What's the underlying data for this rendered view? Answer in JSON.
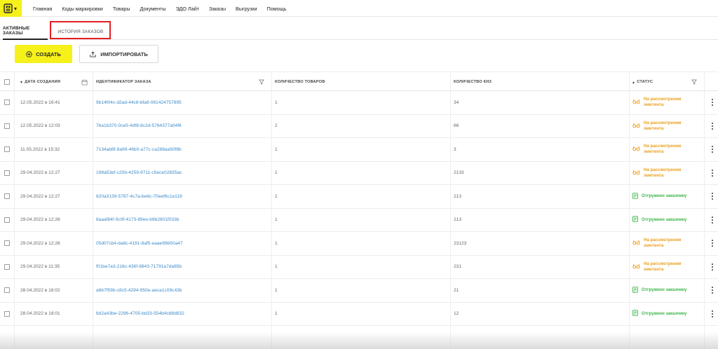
{
  "nav": {
    "items": [
      "Главная",
      "Коды маркировки",
      "Товары",
      "Документы",
      "ЭДО Лайт",
      "Заказы",
      "Выгрузки",
      "Помощь"
    ]
  },
  "tabs": {
    "active": "Активные заказы",
    "history": "История заказов"
  },
  "toolbar": {
    "create_label": "СОЗДАТЬ",
    "import_label": "ИМПОРТИРОВАТЬ"
  },
  "table": {
    "headers": {
      "date": "Дата создания",
      "id": "Идентификатор заказа",
      "qty": "Количество товаров",
      "kiz": "Количество КИЗ",
      "status": "Статус"
    },
    "rows": [
      {
        "date": "12.05.2022 в 16:41",
        "id": "9b14f04c-d2ad-44c8-bfa8-081424757895",
        "qty": "1",
        "kiz": "34",
        "status": "На рассмотрении эмитента",
        "status_type": "review"
      },
      {
        "date": "12.05.2022 в 12:03",
        "id": "7ba1b370-0ce5-4df8-8c2d-5764377a04f6",
        "qty": "2",
        "kiz": "66",
        "status": "На рассмотрении эмитента",
        "status_type": "review"
      },
      {
        "date": "11.05.2022 в 15:32",
        "id": "7134ab8f-8a99-46b0-a77c-ca288aa50f8b",
        "qty": "1",
        "kiz": "3",
        "status": "На рассмотрении эмитента",
        "status_type": "review"
      },
      {
        "date": "29.04.2022 в 12:27",
        "id": "198a53ef-c20b-4259-9711-c5ece02835ac",
        "qty": "1",
        "kiz": "2133",
        "status": "На рассмотрении эмитента",
        "status_type": "review"
      },
      {
        "date": "29.04.2022 в 12:27",
        "id": "820a3139-5787-4c7a-be6c-70eef8c1e119",
        "qty": "1",
        "kiz": "213",
        "status": "Отгружено заказчику",
        "status_type": "shipped"
      },
      {
        "date": "29.04.2022 в 12:26",
        "id": "8aaaf84f-9c9f-4173-89ee-b9b2801f033b",
        "qty": "1",
        "kiz": "213",
        "status": "Отгружено заказчику",
        "status_type": "shipped"
      },
      {
        "date": "29.04.2022 в 12:26",
        "id": "05d07cb4-da8c-4191-8af5-eaae99b50a47",
        "qty": "1",
        "kiz": "23123",
        "status": "На рассмотрении эмитента",
        "status_type": "review"
      },
      {
        "date": "29.04.2022 в 11:35",
        "id": "f01be7a3-216c-436f-8843-71791a7da85b",
        "qty": "1",
        "kiz": "231",
        "status": "На рассмотрении эмитента",
        "status_type": "review"
      },
      {
        "date": "28.04.2022 в 18:02",
        "id": "a6b7f59b-c8c5-4294-950e-aeca1c09c43b",
        "qty": "1",
        "kiz": "21",
        "status": "Отгружено заказчику",
        "status_type": "shipped"
      },
      {
        "date": "28.04.2022 в 18:01",
        "id": "6d2a43be-2296-4705-bd33-554b4c88d832",
        "qty": "1",
        "kiz": "12",
        "status": "Отгружено заказчику",
        "status_type": "shipped"
      }
    ]
  },
  "colors": {
    "accent": "#f6f01b",
    "review": "#e9a020",
    "shipped": "#3bb54a",
    "link": "#3d8bc9",
    "highlight": "#e51e25"
  },
  "icons": {
    "logo": "logo-icon",
    "create": "plus-circle-icon",
    "import": "upload-icon",
    "review": "glasses-icon",
    "shipped": "document-check-icon"
  }
}
